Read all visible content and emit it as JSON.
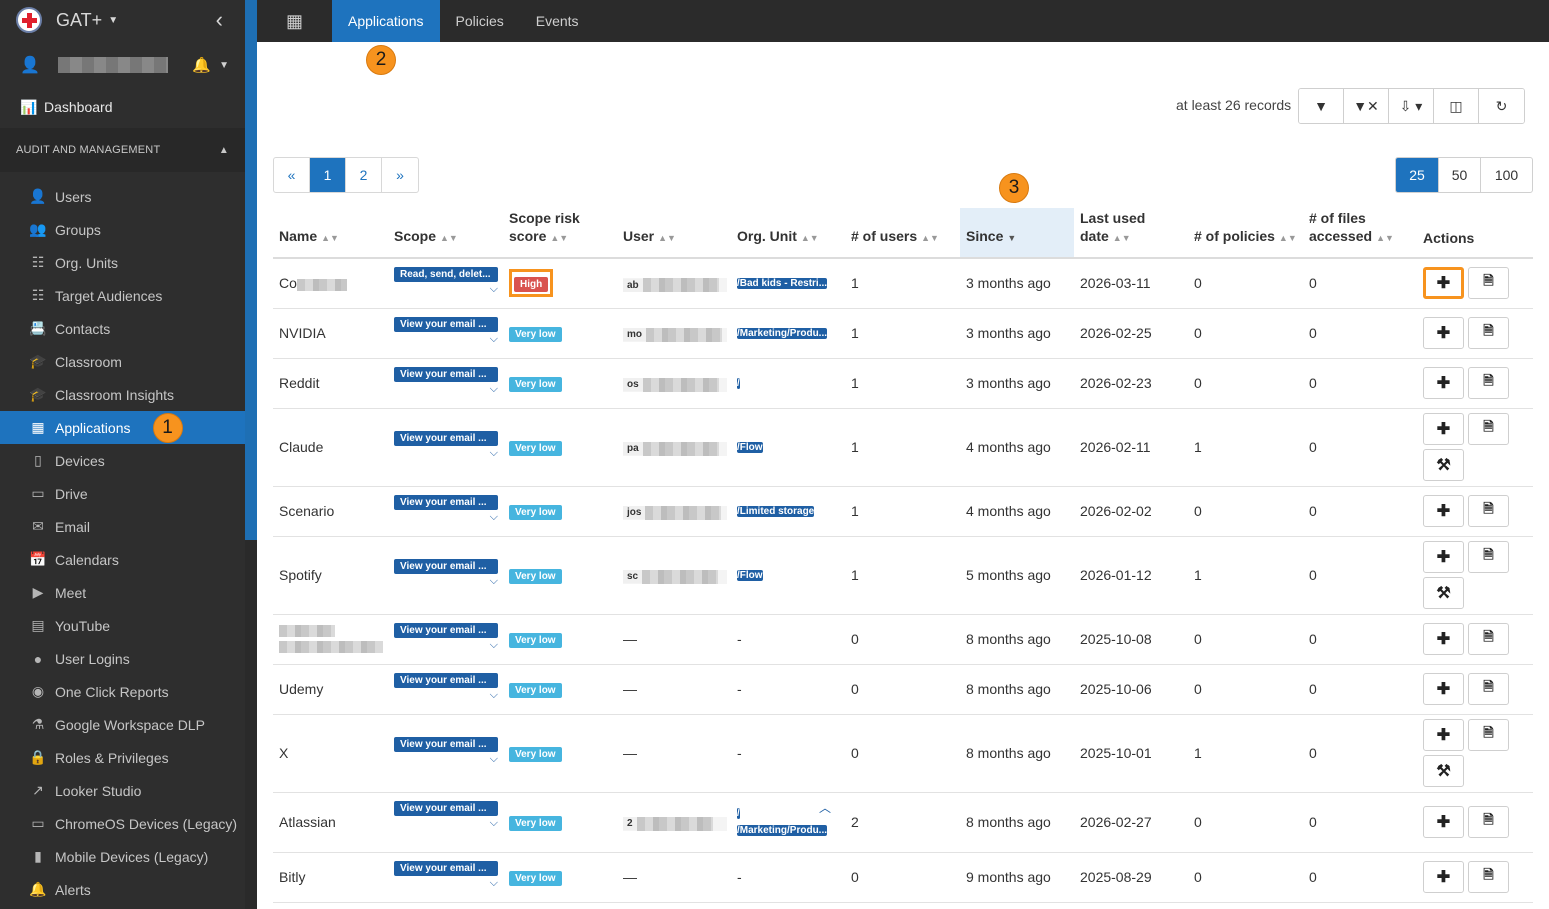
{
  "app": {
    "name": "GAT+",
    "collapse_icon": "chevron-left-icon"
  },
  "sidebar": {
    "dashboard_label": "Dashboard",
    "section_label": "AUDIT AND MANAGEMENT",
    "items": [
      {
        "label": "Users",
        "icon": "user-icon"
      },
      {
        "label": "Groups",
        "icon": "group-icon"
      },
      {
        "label": "Org. Units",
        "icon": "sitemap-icon"
      },
      {
        "label": "Target Audiences",
        "icon": "sitemap-icon"
      },
      {
        "label": "Contacts",
        "icon": "contact-icon"
      },
      {
        "label": "Classroom",
        "icon": "graduation-cap-icon"
      },
      {
        "label": "Classroom Insights",
        "icon": "graduation-cap-icon"
      },
      {
        "label": "Applications",
        "icon": "grid-icon",
        "active": true,
        "badge": "1"
      },
      {
        "label": "Devices",
        "icon": "device-icon"
      },
      {
        "label": "Drive",
        "icon": "drive-icon"
      },
      {
        "label": "Email",
        "icon": "envelope-icon"
      },
      {
        "label": "Calendars",
        "icon": "calendar-icon"
      },
      {
        "label": "Meet",
        "icon": "video-icon"
      },
      {
        "label": "YouTube",
        "icon": "film-icon"
      },
      {
        "label": "User Logins",
        "icon": "globe-icon"
      },
      {
        "label": "One Click Reports",
        "icon": "eye-icon"
      },
      {
        "label": "Google Workspace DLP",
        "icon": "flask-icon"
      },
      {
        "label": "Roles & Privileges",
        "icon": "lock-icon"
      },
      {
        "label": "Looker Studio",
        "icon": "line-chart-icon"
      },
      {
        "label": "ChromeOS Devices (Legacy)",
        "icon": "laptop-icon"
      },
      {
        "label": "Mobile Devices (Legacy)",
        "icon": "mobile-icon"
      },
      {
        "label": "Alerts",
        "icon": "bell-icon"
      }
    ]
  },
  "topbar": {
    "tabs": [
      {
        "label": "Applications",
        "active": true
      },
      {
        "label": "Policies"
      },
      {
        "label": "Events"
      }
    ],
    "badge": "2"
  },
  "toolbar": {
    "records_text": "at least 26 records"
  },
  "pagination": {
    "prev": "«",
    "pages": [
      "1",
      "2"
    ],
    "next": "»",
    "active_page": "1",
    "page_sizes": [
      "25",
      "50",
      "100"
    ],
    "active_size": "25"
  },
  "table": {
    "sort_badge": "3",
    "columns": [
      "Name",
      "Scope",
      "Scope risk score",
      "User",
      "Org. Unit",
      "# of users",
      "Since",
      "Last used date",
      "# of policies",
      "# of files accessed",
      "Actions"
    ],
    "rows": [
      {
        "name": "Co",
        "scope": "Read, send, delet...",
        "risk": "High",
        "user": "ab",
        "ou": [
          "/Bad kids - Restri..."
        ],
        "users": "1",
        "since": "3 months ago",
        "last_used": "2026-03-11",
        "policies": "0",
        "files": "0"
      },
      {
        "name": "NVIDIA",
        "scope": "View your email ...",
        "risk": "Very low",
        "user": "mo",
        "ou": [
          "/Marketing/Produ..."
        ],
        "users": "1",
        "since": "3 months ago",
        "last_used": "2026-02-25",
        "policies": "0",
        "files": "0"
      },
      {
        "name": "Reddit",
        "scope": "View your email ...",
        "risk": "Very low",
        "user": "os",
        "ou": [
          "/"
        ],
        "users": "1",
        "since": "3 months ago",
        "last_used": "2026-02-23",
        "policies": "0",
        "files": "0"
      },
      {
        "name": "Claude",
        "scope": "View your email ...",
        "risk": "Very low",
        "user": "pa",
        "ou": [
          "/Flow"
        ],
        "users": "1",
        "since": "4 months ago",
        "last_used": "2026-02-11",
        "policies": "1",
        "files": "0"
      },
      {
        "name": "Scenario",
        "scope": "View your email ...",
        "risk": "Very low",
        "user": "jos",
        "ou": [
          "/Limited storage"
        ],
        "users": "1",
        "since": "4 months ago",
        "last_used": "2026-02-02",
        "policies": "0",
        "files": "0"
      },
      {
        "name": "Spotify",
        "scope": "View your email ...",
        "risk": "Very low",
        "user": "sc",
        "ou": [
          "/Flow"
        ],
        "users": "1",
        "since": "5 months ago",
        "last_used": "2026-01-12",
        "policies": "1",
        "files": "0"
      },
      {
        "name": "",
        "scope": "View your email ...",
        "risk": "Very low",
        "user": "—",
        "ou_text": "-",
        "users": "0",
        "since": "8 months ago",
        "last_used": "2025-10-08",
        "policies": "0",
        "files": "0"
      },
      {
        "name": "Udemy",
        "scope": "View your email ...",
        "risk": "Very low",
        "user": "—",
        "ou_text": "-",
        "users": "0",
        "since": "8 months ago",
        "last_used": "2025-10-06",
        "policies": "0",
        "files": "0"
      },
      {
        "name": "X",
        "scope": "View your email ...",
        "risk": "Very low",
        "user": "—",
        "ou_text": "-",
        "users": "0",
        "since": "8 months ago",
        "last_used": "2025-10-01",
        "policies": "1",
        "files": "0"
      },
      {
        "name": "Atlassian",
        "scope": "View your email ...",
        "risk": "Very low",
        "user": "2",
        "ou": [
          "/",
          "/Marketing/Produ..."
        ],
        "users": "2",
        "since": "8 months ago",
        "last_used": "2026-02-27",
        "policies": "0",
        "files": "0"
      },
      {
        "name": "Bitly",
        "scope": "View your email ...",
        "risk": "Very low",
        "user": "—",
        "ou_text": "-",
        "users": "0",
        "since": "9 months ago",
        "last_used": "2025-08-29",
        "policies": "0",
        "files": "0"
      }
    ]
  }
}
